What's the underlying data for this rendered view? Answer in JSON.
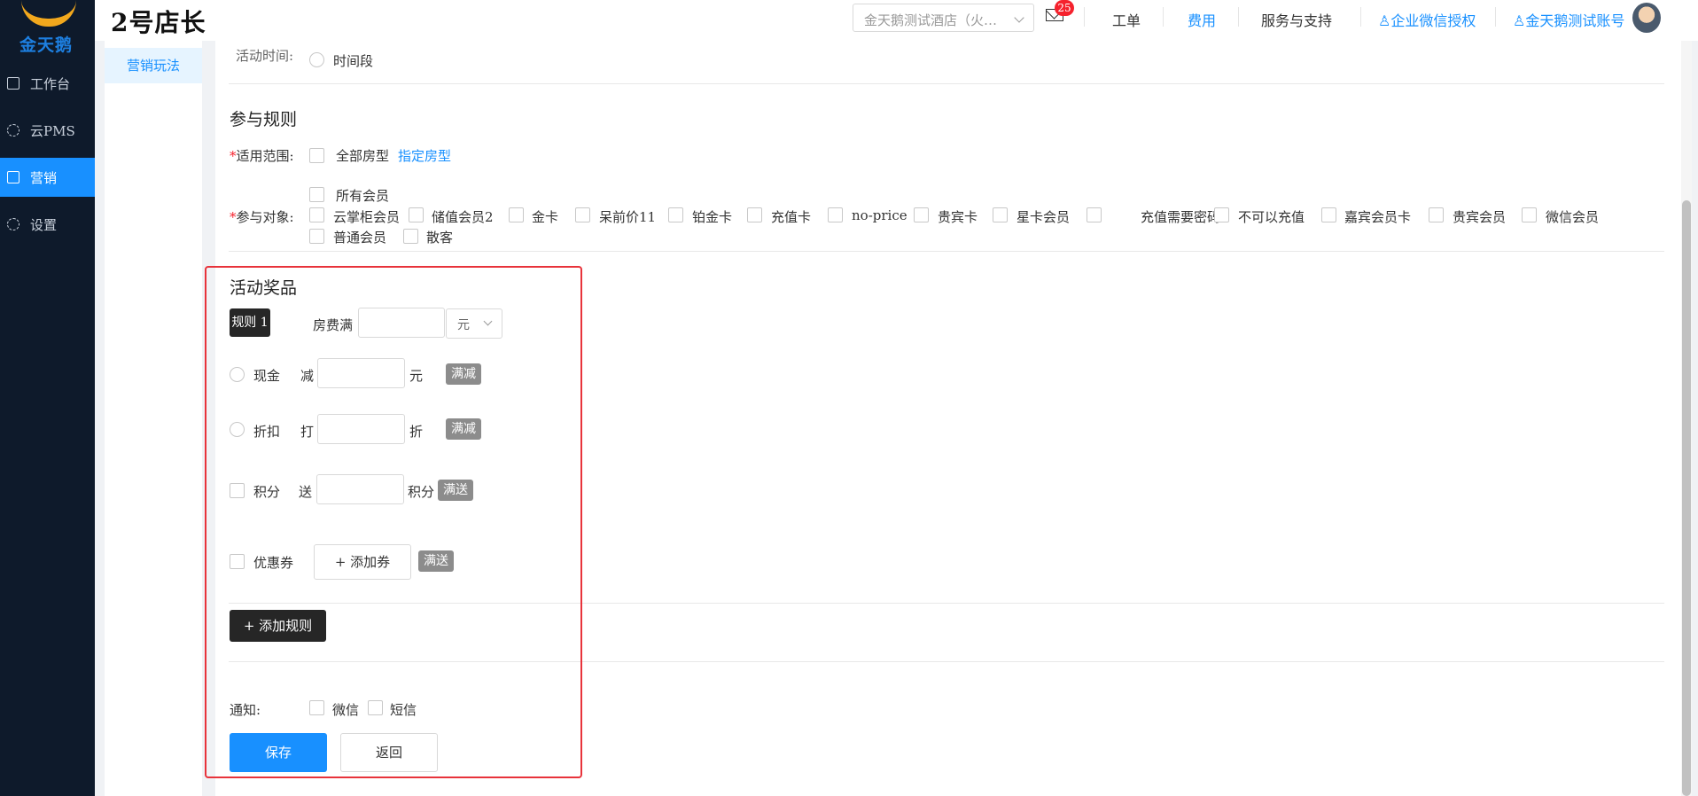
{
  "app": {
    "logo_text": "金天鹅",
    "brand": "2号店长"
  },
  "sidebar": {
    "items": [
      {
        "label": "工作台",
        "icon": "scan-icon",
        "active": false
      },
      {
        "label": "云PMS",
        "icon": "gear-icon",
        "active": false
      },
      {
        "label": "营销",
        "icon": "scan-icon",
        "active": true
      },
      {
        "label": "设置",
        "icon": "gear-icon",
        "active": false
      }
    ]
  },
  "topbar": {
    "hotel_select": "金天鹅测试酒店（火…",
    "mail_badge": "25",
    "links": {
      "ticket": "工单",
      "fees": "费用",
      "support": "服务与支持",
      "wechat_auth": "企业微信授权",
      "account": "金天鹅测试账号"
    }
  },
  "submenu": {
    "active": "营销玩法"
  },
  "form": {
    "activity_time": {
      "label": "活动时间:",
      "option": "时间段"
    },
    "rules_title": "参与规则",
    "scope": {
      "required_mark": "*",
      "label": "适用范围:",
      "option_all": "全部房型",
      "link_specific": "指定房型"
    },
    "targets": {
      "required_mark": "*",
      "label": "参与对象:",
      "all_members": "所有会员",
      "options": [
        "云掌柜会员",
        "储值会员2",
        "金卡",
        "呆前价11",
        "铂金卡",
        "充值卡",
        "no-price",
        "贵宾卡",
        "星卡会员",
        "充值需要密码8",
        "不可以充值",
        "嘉宾会员卡",
        "贵宾会员",
        "微信会员",
        "普通会员",
        "散客"
      ]
    },
    "prizes": {
      "title": "活动奖品",
      "rule_tag": "规则 1",
      "threshold_label": "房费满",
      "threshold_value": "",
      "threshold_unit": "元",
      "cash": {
        "label": "现金",
        "prefix": "减",
        "value": "",
        "unit": "元",
        "tag": "满减"
      },
      "discount": {
        "label": "折扣",
        "prefix": "打",
        "value": "",
        "unit": "折",
        "tag": "满减"
      },
      "points": {
        "label": "积分",
        "prefix": "送",
        "value": "",
        "unit": "积分",
        "tag": "满送"
      },
      "coupon": {
        "label": "优惠券",
        "button": "+ 添加券",
        "tag": "满送"
      },
      "add_rule": "+ 添加规则"
    },
    "notify": {
      "label": "通知:",
      "wechat": "微信",
      "sms": "短信"
    },
    "save": "保存",
    "back": "返回"
  },
  "colors": {
    "primary": "#1890ff",
    "sidebar_bg": "#0e1a2b",
    "highlight": "#e8333b",
    "required": "#f5222d"
  }
}
